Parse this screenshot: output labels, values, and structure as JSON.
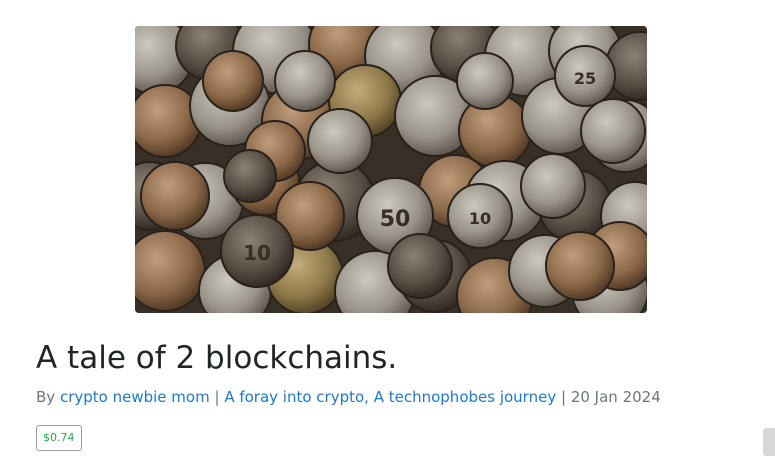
{
  "post": {
    "title": "A tale of 2 blockchains.",
    "by_label": "By",
    "author": "crypto newbie mom",
    "separator": "|",
    "community": "A foray into crypto, A technophobes journey",
    "date": "20 Jan 2024",
    "payout": "$0.74"
  },
  "hero_image": {
    "subject": "coins",
    "coin_labels": [
      "50",
      "10",
      "25",
      "10"
    ]
  },
  "colors": {
    "link": "#1f78c9",
    "payout_green": "#28a745",
    "muted": "#6c757d"
  }
}
